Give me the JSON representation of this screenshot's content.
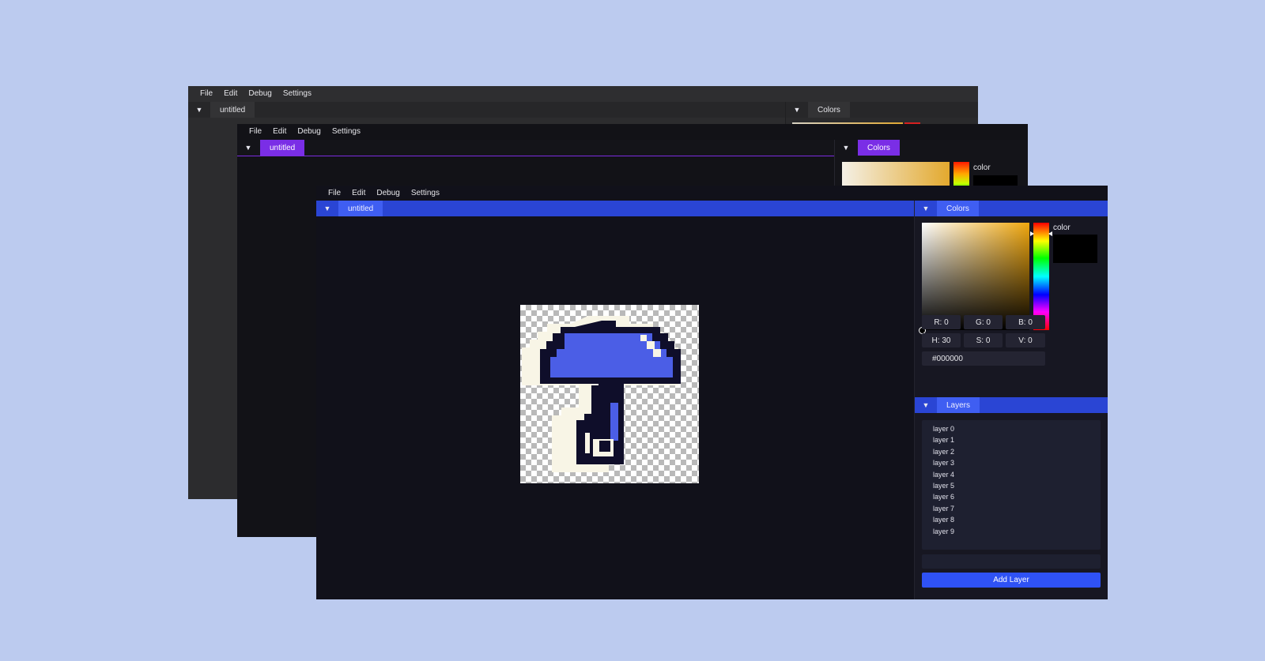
{
  "menu": [
    "File",
    "Edit",
    "Debug",
    "Settings"
  ],
  "document_tab": "untitled",
  "colors_tab": "Colors",
  "layers_tab": "Layers",
  "color_label": "color",
  "rgb": {
    "r": "R: 0",
    "g": "G: 0",
    "b": "B: 0"
  },
  "hsv": {
    "h": "H: 30",
    "s": "S: 0",
    "v": "V: 0"
  },
  "hex": "#000000",
  "layers": [
    "layer 0",
    "layer 1",
    "layer 2",
    "layer 3",
    "layer 4",
    "layer 5",
    "layer 6",
    "layer 7",
    "layer 8",
    "layer 9"
  ],
  "add_layer": "Add Layer",
  "theme_colors": {
    "gray": "#2c2c2e",
    "purple": "#7a2ee6",
    "blue": "#3f5ef2",
    "current_color": "#000000"
  }
}
